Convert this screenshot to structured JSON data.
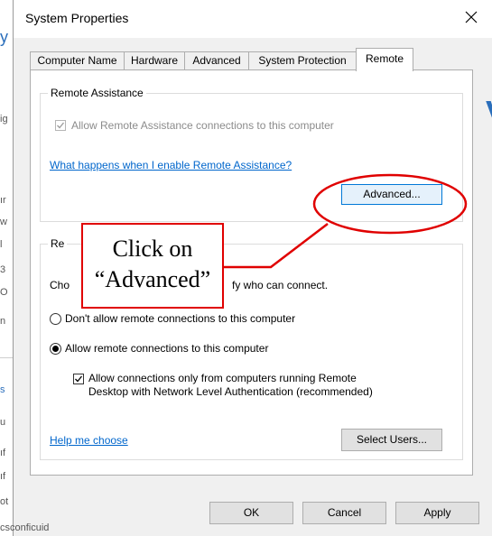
{
  "window": {
    "title": "System Properties"
  },
  "tabs": [
    {
      "label": "Computer Name",
      "active": false
    },
    {
      "label": "Hardware",
      "active": false
    },
    {
      "label": "Advanced",
      "active": false
    },
    {
      "label": "System Protection",
      "active": false
    },
    {
      "label": "Remote",
      "active": true
    }
  ],
  "remote_assistance": {
    "group_label": "Remote Assistance",
    "allow_checkbox_label": "Allow Remote Assistance connections to this computer",
    "allow_checked": true,
    "help_link": "What happens when I enable Remote Assistance?",
    "advanced_button": "Advanced..."
  },
  "remote_desktop": {
    "group_label": "Re",
    "intro_start": "Cho",
    "intro_end": "fy who can connect.",
    "dont_allow_label": "Don't allow remote connections to this computer",
    "allow_label": "Allow remote connections to this computer",
    "selected_option": "allow",
    "nla_line1": "Allow connections only from computers running Remote",
    "nla_line2": "Desktop with Network Level Authentication (recommended)",
    "nla_checked": true,
    "help_link": "Help me choose",
    "select_users_button": "Select Users..."
  },
  "footer": {
    "ok": "OK",
    "cancel": "Cancel",
    "apply": "Apply"
  },
  "annotation": {
    "line1": "Click on",
    "line2": "“Advanced”",
    "color": "#e00000"
  },
  "background_fragments": [
    "y",
    "ig",
    "ır",
    "w",
    "l",
    "3",
    "O",
    "n",
    "s",
    "u",
    "ıf",
    "ıf",
    "ot",
    "csconficuid"
  ],
  "colors": {
    "link": "#0066cc",
    "focus": "#0078d7",
    "annotation": "#e00000"
  }
}
